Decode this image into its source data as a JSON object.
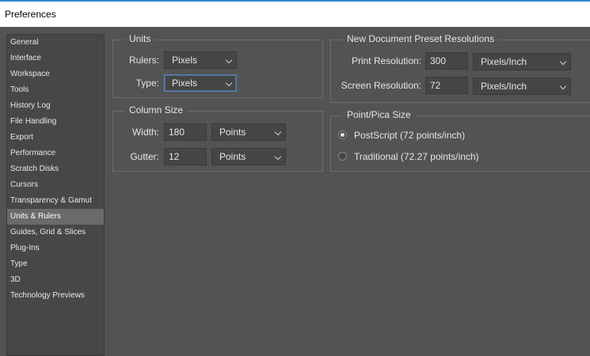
{
  "window": {
    "title": "Preferences"
  },
  "sidebar": {
    "items": [
      {
        "label": "General"
      },
      {
        "label": "Interface"
      },
      {
        "label": "Workspace"
      },
      {
        "label": "Tools"
      },
      {
        "label": "History Log"
      },
      {
        "label": "File Handling"
      },
      {
        "label": "Export"
      },
      {
        "label": "Performance"
      },
      {
        "label": "Scratch Disks"
      },
      {
        "label": "Cursors"
      },
      {
        "label": "Transparency & Gamut"
      },
      {
        "label": "Units & Rulers"
      },
      {
        "label": "Guides, Grid & Slices"
      },
      {
        "label": "Plug-Ins"
      },
      {
        "label": "Type"
      },
      {
        "label": "3D"
      },
      {
        "label": "Technology Previews"
      }
    ],
    "selected": "Units & Rulers"
  },
  "units": {
    "legend": "Units",
    "rulers_label": "Rulers:",
    "rulers_value": "Pixels",
    "type_label": "Type:",
    "type_value": "Pixels"
  },
  "column_size": {
    "legend": "Column Size",
    "width_label": "Width:",
    "width_value": "180",
    "width_unit": "Points",
    "gutter_label": "Gutter:",
    "gutter_value": "12",
    "gutter_unit": "Points"
  },
  "preset_resolutions": {
    "legend": "New Document Preset Resolutions",
    "print_label": "Print Resolution:",
    "print_value": "300",
    "print_unit": "Pixels/Inch",
    "screen_label": "Screen Resolution:",
    "screen_value": "72",
    "screen_unit": "Pixels/Inch"
  },
  "point_pica": {
    "legend": "Point/Pica Size",
    "postscript_label": "PostScript (72 points/inch)",
    "traditional_label": "Traditional (72.27 points/inch)",
    "selected": "postscript"
  }
}
